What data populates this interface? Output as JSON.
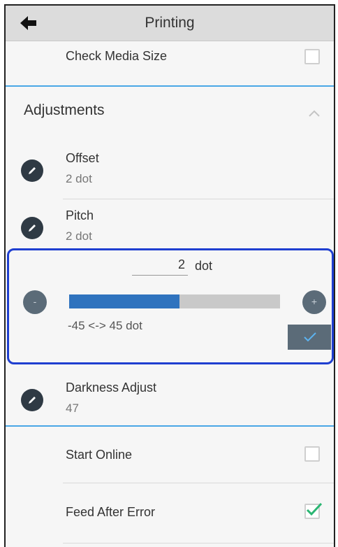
{
  "header": {
    "title": "Printing"
  },
  "items": {
    "check_media_size": {
      "label": "Check Media Size",
      "checked": false
    },
    "adjustments": {
      "label": "Adjustments"
    },
    "offset": {
      "label": "Offset",
      "value": "2 dot"
    },
    "pitch": {
      "label": "Pitch",
      "value": "2 dot"
    },
    "editor": {
      "value": "2",
      "unit": "dot",
      "minus_label": "-",
      "plus_label": "+",
      "range_text": "-45 <-> 45 dot",
      "min": -45,
      "max": 45,
      "current": 2
    },
    "darkness_adjust": {
      "label": "Darkness Adjust",
      "value": "47"
    },
    "start_online": {
      "label": "Start Online",
      "checked": false
    },
    "feed_after_error": {
      "label": "Feed After Error",
      "checked": true
    }
  },
  "colors": {
    "accent_blue": "#49a7e6",
    "editor_border": "#1f3fd0",
    "slider_fill": "#2f73be",
    "check_green": "#2bb673",
    "button_slate": "#5b6b78"
  },
  "icons": {
    "back": "back-arrow-icon",
    "collapse": "chevron-up-icon",
    "edit": "pencil-icon",
    "confirm": "checkmark-icon"
  }
}
